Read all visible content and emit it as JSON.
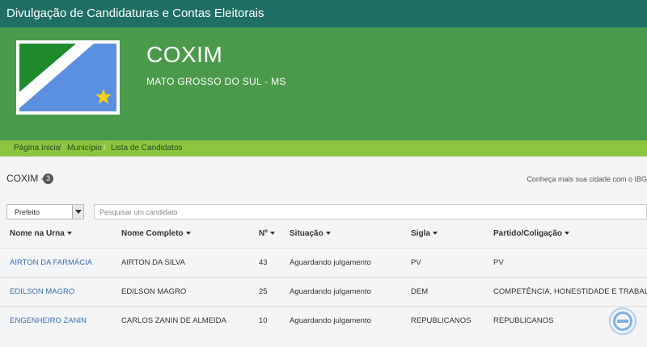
{
  "header": {
    "title": "Divulgação de Candidaturas e Contas Eleitorais"
  },
  "banner": {
    "city": "COXIM",
    "state": "MATO GROSSO DO SUL - MS"
  },
  "breadcrumb": [
    "Página Inicial",
    "Município",
    "Lista de Candidatos"
  ],
  "summary": {
    "title": "COXIM -",
    "count": "3",
    "ibge_link": "Conheça mais sua cidade com o IBGE"
  },
  "filters": {
    "cargo": "Prefeito",
    "search_placeholder": "Pesquisar um candidato"
  },
  "table": {
    "headers": [
      "Nome na Urna",
      "Nome Completo",
      "Nº",
      "Situação",
      "Sigla",
      "Partido/Coligação"
    ],
    "rows": [
      [
        "AIRTON DA FARMÁCIA",
        "AIRTON DA SILVA",
        "43",
        "Aguardando julgamento",
        "PV",
        "PV"
      ],
      [
        "EDILSON MAGRO",
        "EDILSON MAGRO",
        "25",
        "Aguardando julgamento",
        "DEM",
        "COMPETÊNCIA, HONESTIDADE E TRABALHO"
      ],
      [
        "ENGENHEIRO ZANIN",
        "CARLOS ZANIN DE ALMEIDA",
        "10",
        "Aguardando julgamento",
        "REPUBLICANOS",
        "REPUBLICANOS"
      ]
    ]
  },
  "icons": {
    "fab": "eleicoes-logo-icon",
    "flag": "ms-flag-icon"
  },
  "colors": {
    "topbar": "#1f6f66",
    "banner": "#4b9a4b",
    "breadcrumb": "#8cc63f",
    "link": "#3b6fb0"
  }
}
